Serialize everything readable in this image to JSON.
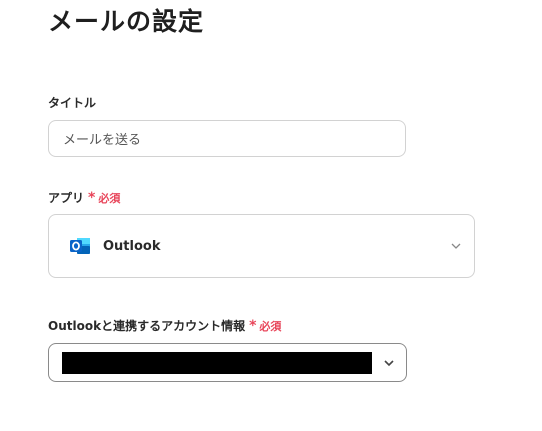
{
  "page": {
    "title": "メールの設定"
  },
  "title_field": {
    "label": "タイトル",
    "value": "メールを送る"
  },
  "app_field": {
    "label": "アプリ",
    "required_mark": "*",
    "required_text": "必須",
    "selected_app": "Outlook",
    "icon": "outlook-icon",
    "dropdown_icon": "chevron-down-icon"
  },
  "account_field": {
    "label": "Outlookと連携するアカウント情報",
    "required_mark": "*",
    "required_text": "必須",
    "value_redacted": true,
    "dropdown_icon": "chevron-down-icon"
  },
  "colors": {
    "required": "#e8455a",
    "outlook_blue": "#0a64c8",
    "border": "#d2d2d2",
    "text": "#222222"
  }
}
